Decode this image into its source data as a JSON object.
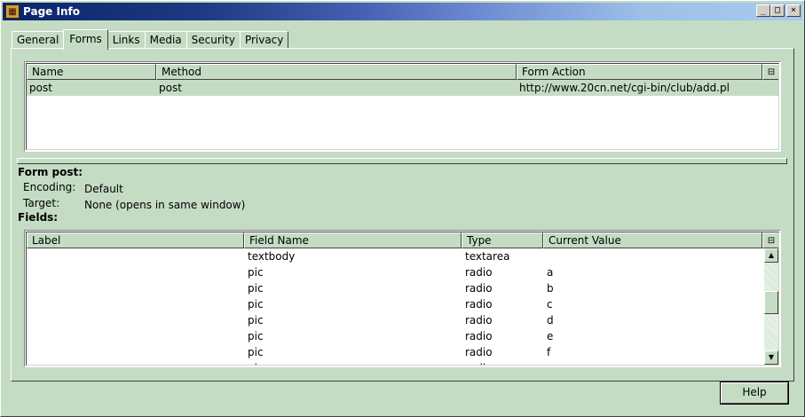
{
  "window": {
    "title": "Page Info"
  },
  "tabs": [
    {
      "label": "General"
    },
    {
      "label": "Forms"
    },
    {
      "label": "Links"
    },
    {
      "label": "Media"
    },
    {
      "label": "Security"
    },
    {
      "label": "Privacy"
    }
  ],
  "active_tab": "Forms",
  "forms_table": {
    "columns": [
      "Name",
      "Method",
      "Form Action"
    ],
    "rows": [
      {
        "name": "post",
        "method": "post",
        "action": "http://www.20cn.net/cgi-bin/club/add.pl"
      }
    ]
  },
  "form_detail": {
    "heading": "Form post:",
    "encoding_label": "Encoding:",
    "encoding_value": "Default",
    "target_label": "Target:",
    "target_value": "None (opens in same window)",
    "fields_heading": "Fields:"
  },
  "fields_table": {
    "columns": [
      "Label",
      "Field Name",
      "Type",
      "Current Value"
    ],
    "rows": [
      {
        "label": "",
        "field": "textbody",
        "type": "textarea",
        "value": ""
      },
      {
        "label": "",
        "field": "pic",
        "type": "radio",
        "value": "a"
      },
      {
        "label": "",
        "field": "pic",
        "type": "radio",
        "value": "b"
      },
      {
        "label": "",
        "field": "pic",
        "type": "radio",
        "value": "c"
      },
      {
        "label": "",
        "field": "pic",
        "type": "radio",
        "value": "d"
      },
      {
        "label": "",
        "field": "pic",
        "type": "radio",
        "value": "e"
      },
      {
        "label": "",
        "field": "pic",
        "type": "radio",
        "value": "f"
      },
      {
        "label": "",
        "field": "pic",
        "type": "radio",
        "value": "g"
      }
    ]
  },
  "buttons": {
    "help": "Help"
  },
  "icons": {
    "app": "page-info-icon",
    "minimize": "minimize-icon",
    "maximize": "maximize-icon",
    "close": "close-icon",
    "column_picker": "column-picker-icon",
    "scroll_up": "arrow-up-icon",
    "scroll_down": "arrow-down-icon"
  }
}
